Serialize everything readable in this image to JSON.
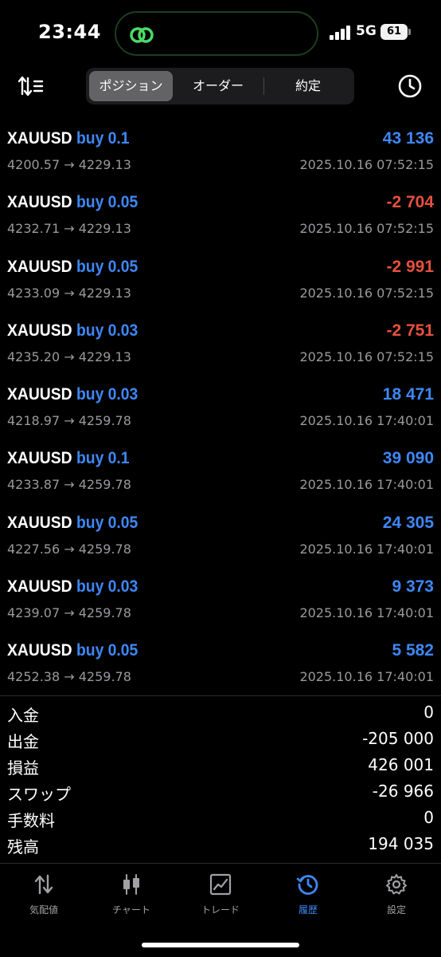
{
  "status": {
    "time": "23:44",
    "network": "5G",
    "battery": "61"
  },
  "toolbar": {
    "sort_icon": "sort-icon",
    "history_icon": "clock-icon",
    "segments": [
      "ポジション",
      "オーダー",
      "約定"
    ],
    "active_segment": "ポジション"
  },
  "trades": [
    {
      "symbol": "XAUUSD",
      "side": "buy 0.1",
      "profit": "43 136",
      "prices": "4200.57 → 4229.13",
      "time": "2025.10.16 07:52:15"
    },
    {
      "symbol": "XAUUSD",
      "side": "buy 0.05",
      "profit": "-2 704",
      "prices": "4232.71 → 4229.13",
      "time": "2025.10.16 07:52:15"
    },
    {
      "symbol": "XAUUSD",
      "side": "buy 0.05",
      "profit": "-2 991",
      "prices": "4233.09 → 4229.13",
      "time": "2025.10.16 07:52:15"
    },
    {
      "symbol": "XAUUSD",
      "side": "buy 0.03",
      "profit": "-2 751",
      "prices": "4235.20 → 4229.13",
      "time": "2025.10.16 07:52:15"
    },
    {
      "symbol": "XAUUSD",
      "side": "buy 0.03",
      "profit": "18 471",
      "prices": "4218.97 → 4259.78",
      "time": "2025.10.16 17:40:01"
    },
    {
      "symbol": "XAUUSD",
      "side": "buy 0.1",
      "profit": "39 090",
      "prices": "4233.87 → 4259.78",
      "time": "2025.10.16 17:40:01"
    },
    {
      "symbol": "XAUUSD",
      "side": "buy 0.05",
      "profit": "24 305",
      "prices": "4227.56 → 4259.78",
      "time": "2025.10.16 17:40:01"
    },
    {
      "symbol": "XAUUSD",
      "side": "buy 0.03",
      "profit": "9 373",
      "prices": "4239.07 → 4259.78",
      "time": "2025.10.16 17:40:01"
    },
    {
      "symbol": "XAUUSD",
      "side": "buy 0.05",
      "profit": "5 582",
      "prices": "4252.38 → 4259.78",
      "time": "2025.10.16 17:40:01"
    }
  ],
  "summary": [
    {
      "label": "入金",
      "value": "0"
    },
    {
      "label": "出金",
      "value": "-205 000"
    },
    {
      "label": "損益",
      "value": "426 001"
    },
    {
      "label": "スワップ",
      "value": "-26 966"
    },
    {
      "label": "手数料",
      "value": "0"
    },
    {
      "label": "残高",
      "value": "194 035"
    }
  ],
  "tabs": [
    {
      "label": "気配値",
      "icon": "quotes-arrows-icon"
    },
    {
      "label": "チャート",
      "icon": "candlestick-chart-icon"
    },
    {
      "label": "トレード",
      "icon": "trade-chart-icon"
    },
    {
      "label": "履歴",
      "icon": "history-icon",
      "active": true
    },
    {
      "label": "設定",
      "icon": "gear-icon"
    }
  ],
  "colors": {
    "accent_blue": "#3f87f5",
    "loss_red": "#e7513f",
    "background": "#000000",
    "muted_text": "#9a9a9e"
  }
}
